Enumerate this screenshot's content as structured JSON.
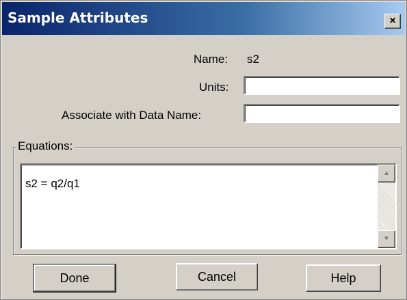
{
  "window": {
    "title": "Sample Attributes",
    "close_label": "×"
  },
  "form": {
    "name_label": "Name:",
    "name_value": "s2",
    "units_label": "Units:",
    "units_value": "",
    "associate_label": "Associate with Data Name:",
    "associate_value": ""
  },
  "equations": {
    "group_label": "Equations:",
    "text": "s2 = q2/q1"
  },
  "scrollbar": {
    "up_arrow": "▲",
    "down_arrow": "▼"
  },
  "buttons": {
    "done": "Done",
    "cancel": "Cancel",
    "help": "Help"
  }
}
